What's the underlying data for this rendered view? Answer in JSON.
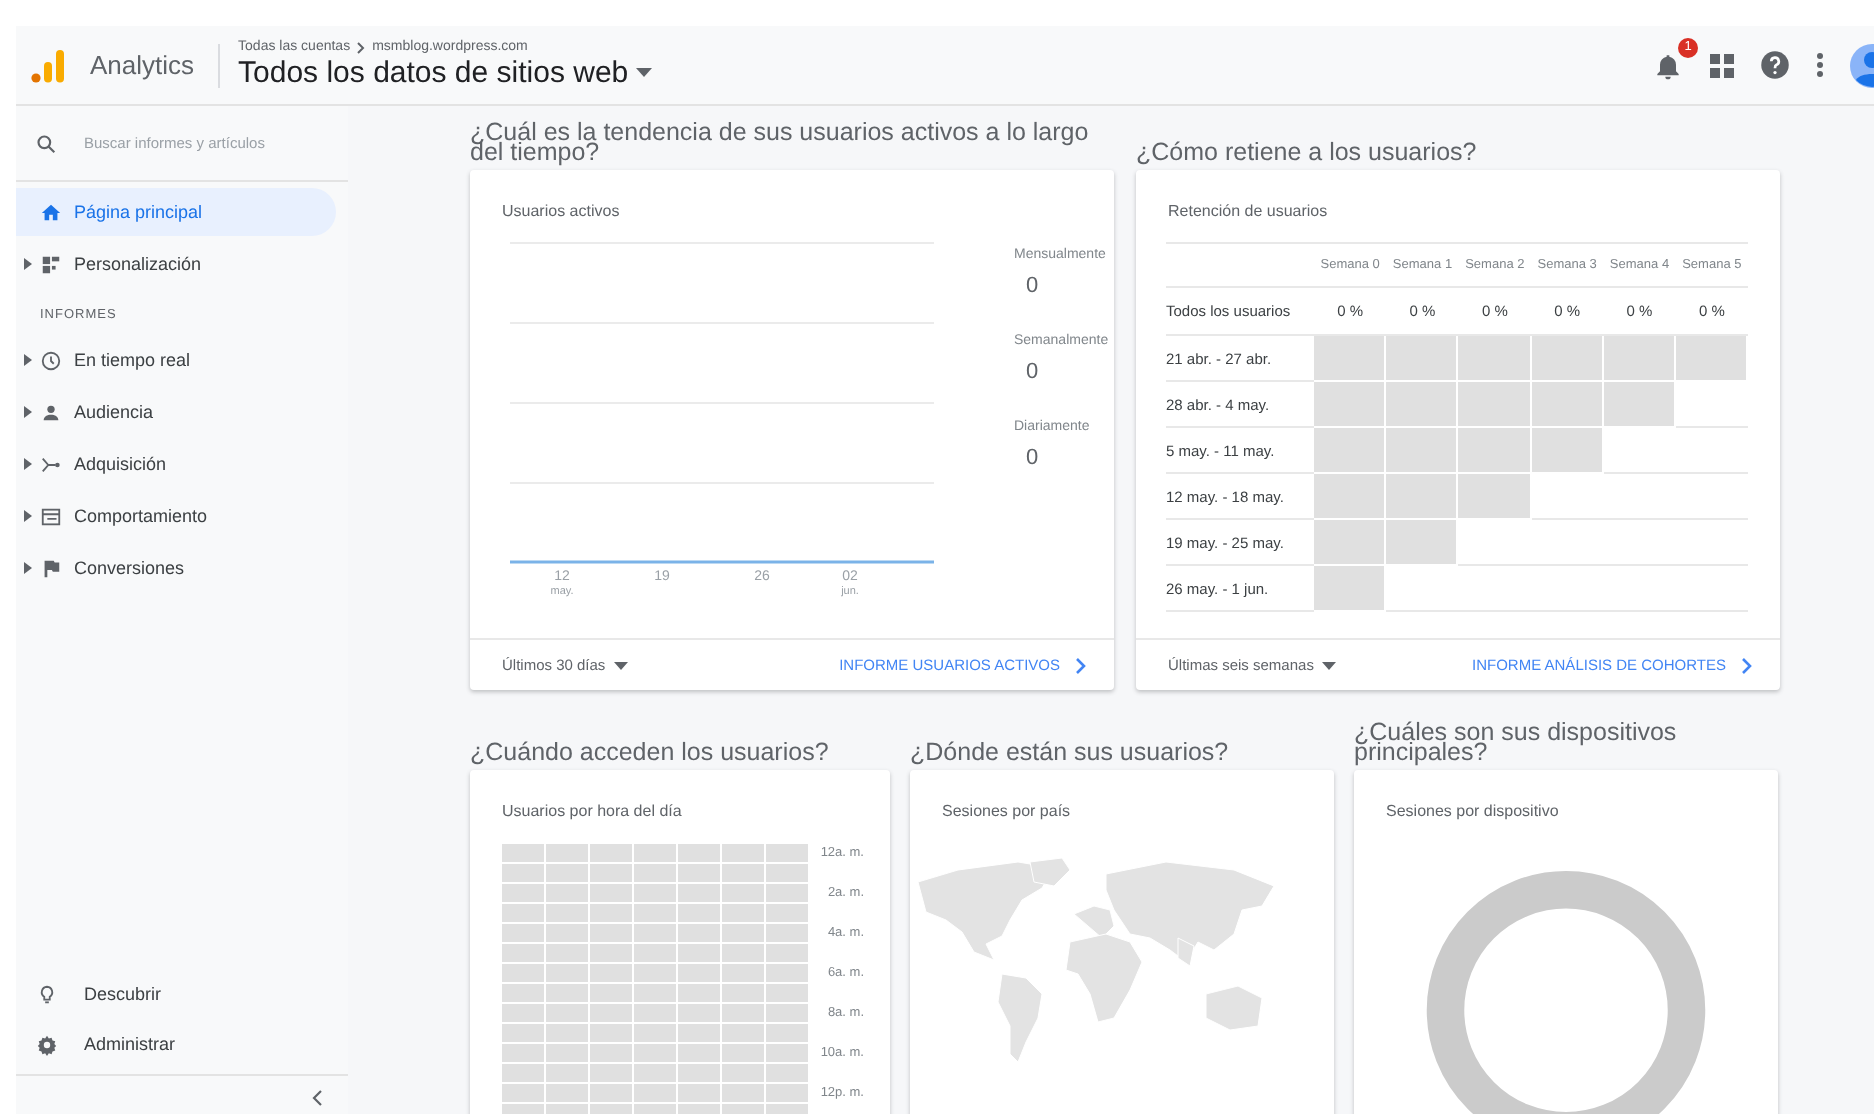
{
  "header": {
    "app_name": "Analytics",
    "breadcrumb": [
      "Todas las cuentas",
      "msmblog.wordpress.com"
    ],
    "view": "Todos los datos de sitios web",
    "notifications": "1"
  },
  "sidebar": {
    "search": {
      "placeholder": "Buscar informes y artículos"
    },
    "top_items": [
      {
        "label": "Página principal",
        "selected": true,
        "expandable": false
      },
      {
        "label": "Personalización",
        "selected": false,
        "expandable": true
      }
    ],
    "section": "INFORMES",
    "report_items": [
      {
        "label": "En tiempo real",
        "selected": false,
        "expandable": true
      },
      {
        "label": "Audiencia",
        "selected": false,
        "expandable": true
      },
      {
        "label": "Adquisición",
        "selected": false,
        "expandable": true
      },
      {
        "label": "Comportamiento",
        "selected": false,
        "expandable": true
      },
      {
        "label": "Conversiones",
        "selected": false,
        "expandable": true
      }
    ],
    "bottom_items": [
      {
        "label": "Descubrir",
        "selected": false
      },
      {
        "label": "Administrar",
        "selected": false
      }
    ]
  },
  "active_users": {
    "question": "¿Cuál es la tendencia de sus usuarios activos a lo largo del tiempo?",
    "title": "Usuarios activos",
    "x_ticks": [
      {
        "day": "12",
        "month": "may."
      },
      {
        "day": "19"
      },
      {
        "day": "26"
      },
      {
        "day": "02",
        "month": "jun."
      }
    ],
    "metrics": [
      {
        "label": "Mensualmente",
        "value": "0"
      },
      {
        "label": "Semanalmente",
        "value": "0"
      },
      {
        "label": "Diariamente",
        "value": "0"
      }
    ],
    "range": "Últimos 30 días",
    "report_link": "INFORME USUARIOS ACTIVOS"
  },
  "retention": {
    "question": "¿Cómo retiene a los usuarios?",
    "title": "Retención de usuarios",
    "weeks": [
      "Semana 0",
      "Semana 1",
      "Semana 2",
      "Semana 3",
      "Semana 4",
      "Semana 5"
    ],
    "totals_label": "Todos los usuarios",
    "totals": [
      "0 %",
      "0 %",
      "0 %",
      "0 %",
      "0 %",
      "0 %"
    ],
    "cohorts": [
      {
        "label": "21 abr. - 27 abr.",
        "filled": [
          true,
          true,
          true,
          true,
          true,
          true
        ]
      },
      {
        "label": "28 abr. - 4 may.",
        "filled": [
          true,
          true,
          true,
          true,
          true,
          false
        ]
      },
      {
        "label": "5 may. - 11 may.",
        "filled": [
          true,
          true,
          true,
          true,
          false,
          false
        ]
      },
      {
        "label": "12 may. - 18 may.",
        "filled": [
          true,
          true,
          true,
          false,
          false,
          false
        ]
      },
      {
        "label": "19 may. - 25 may.",
        "filled": [
          true,
          true,
          false,
          false,
          false,
          false
        ]
      },
      {
        "label": "26 may. - 1 jun.",
        "filled": [
          true,
          false,
          false,
          false,
          false,
          false
        ]
      }
    ],
    "range": "Últimas seis semanas",
    "report_link": "INFORME ANÁLISIS DE COHORTES"
  },
  "hours": {
    "question": "¿Cuándo acceden los usuarios?",
    "title": "Usuarios por hora del día",
    "hour_labels": [
      "12a. m.",
      "2a. m.",
      "4a. m.",
      "6a. m.",
      "8a. m.",
      "10a. m.",
      "12p. m."
    ]
  },
  "countries": {
    "question": "¿Dónde están sus usuarios?",
    "title": "Sesiones por país"
  },
  "devices": {
    "question": "¿Cuáles son sus dispositivos principales?",
    "title": "Sesiones por dispositivo"
  }
}
